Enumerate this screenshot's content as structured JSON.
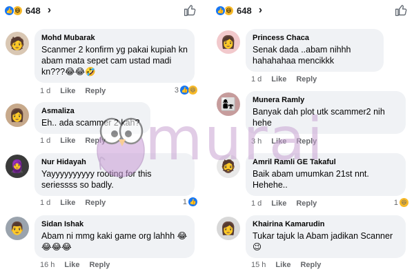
{
  "left_panel": {
    "reaction_count": "648",
    "comments": [
      {
        "name": "Mohd Mubarak",
        "text": "Scanmer 2 konfirm yg pakai kupiah kn abam mata sepet cam ustad madi kn???😂😂🤣",
        "time": "1 d",
        "like": "Like",
        "reply": "Reply",
        "reactions": "3"
      },
      {
        "name": "Asmaliza",
        "text": "Eh.. ada scammer 2 kah?",
        "time": "1 d",
        "like": "Like",
        "reply": "Reply",
        "reactions": ""
      },
      {
        "name": "Nur Hidayah",
        "text": "Yayyyyyyyyyy rooting for this seriessss so badly.",
        "time": "1 d",
        "like": "Like",
        "reply": "Reply",
        "reactions": "1"
      },
      {
        "name": "Sidan Ishak",
        "text": "Abam ni mmg kaki game org lahhh 😂😂😂😂",
        "time": "16 h",
        "like": "Like",
        "reply": "Reply",
        "reactions": ""
      }
    ]
  },
  "right_panel": {
    "reaction_count": "648",
    "comments": [
      {
        "name": "Princess Chaca",
        "text": "Senak dada ..abam nihhh hahahahaa mencikkk",
        "time": "1 d",
        "like": "Like",
        "reply": "Reply",
        "reactions": ""
      },
      {
        "name": "Munera Ramly",
        "text": "Banyak dah plot utk scammer2 nih hehe",
        "time": "3 h",
        "like": "Like",
        "reply": "Reply",
        "reactions": ""
      },
      {
        "name": "Amril Ramli GE Takaful",
        "text": "Baik abam umumkan 21st nnt. Hehehe..",
        "time": "1 d",
        "like": "Like",
        "reply": "Reply",
        "reactions": "1"
      },
      {
        "name": "Khairina Kamarudin",
        "text": "Tukar tajuk la Abam jadikan Scanner 😉",
        "time": "15 h",
        "like": "Like",
        "reply": "Reply",
        "reactions": ""
      }
    ]
  },
  "watermark": {
    "text": "murai"
  },
  "icons": {
    "like": "like-icon",
    "haha": "haha-icon",
    "thumb": "thumbs-up-outline-icon",
    "chevron": "chevron-right-icon"
  },
  "colors": {
    "accent": "#1877f2",
    "bubble": "#f0f2f5",
    "muted": "#65676b",
    "watermark": "#c9a4d3"
  }
}
